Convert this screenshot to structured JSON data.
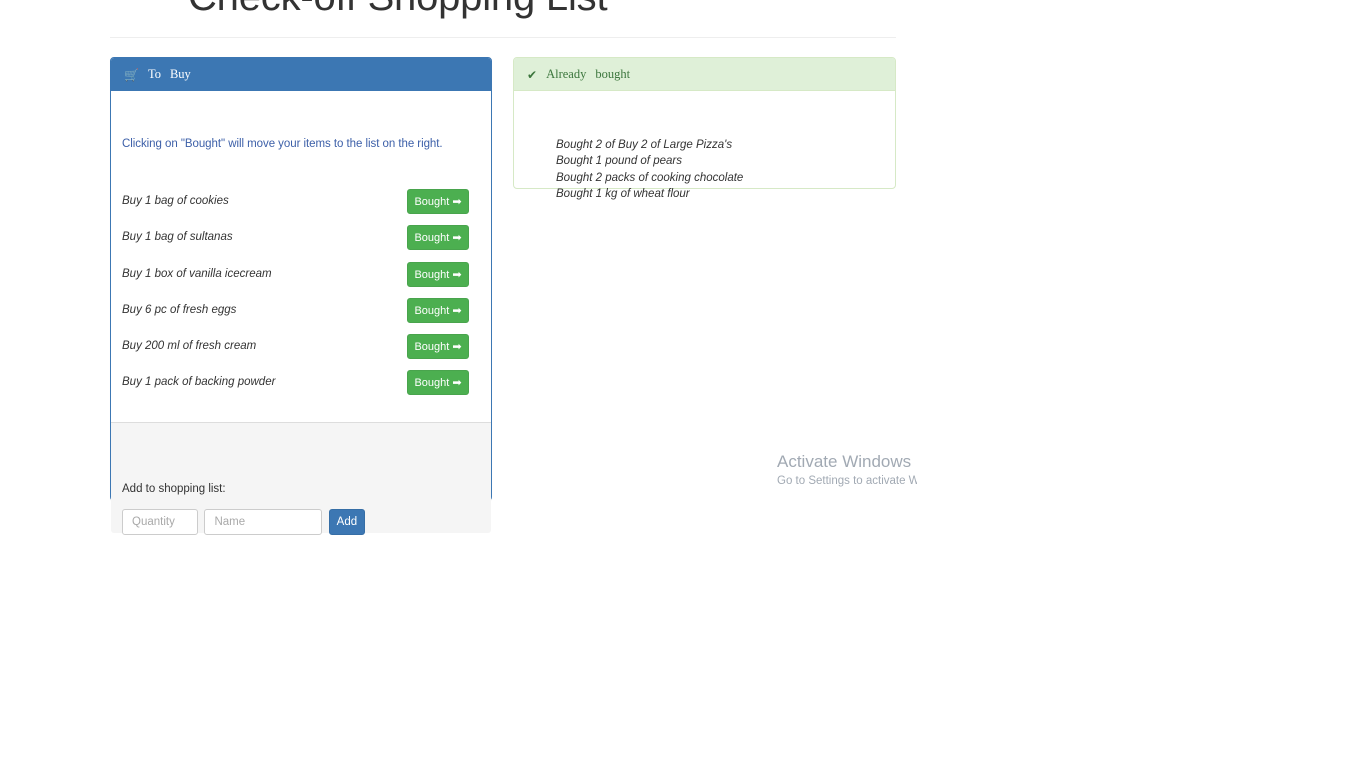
{
  "page": {
    "title": "Check-off Shopping List"
  },
  "colors": {
    "primary_blue": "#3c77b3",
    "success_green_bg": "#dff0d8",
    "success_green_text": "#3c763d",
    "bought_button_green": "#4caf50",
    "note_text_blue": "#3c5fa8",
    "footer_grey": "#f5f5f5"
  },
  "to_buy_panel": {
    "icon": "shopping-cart-icon",
    "icon_glyph": "🛒",
    "heading_word_1": "To",
    "heading_word_2": "Buy",
    "note": "Clicking on \"Bought\" will move your items to the list on the right.",
    "items": [
      {
        "label": "Buy 1 bag of cookies",
        "button": "Bought",
        "arrow": "➡"
      },
      {
        "label": "Buy 1 bag of sultanas",
        "button": "Bought",
        "arrow": "➡"
      },
      {
        "label": "Buy 1 box of vanilla icecream",
        "button": "Bought",
        "arrow": "➡"
      },
      {
        "label": "Buy 6 pc of fresh eggs",
        "button": "Bought",
        "arrow": "➡"
      },
      {
        "label": "Buy 200 ml of fresh cream",
        "button": "Bought",
        "arrow": "➡"
      },
      {
        "label": "Buy 1 pack of backing powder",
        "button": "Bought",
        "arrow": "➡"
      }
    ],
    "footer": {
      "add_label": "Add to shopping list:",
      "quantity_placeholder": "Quantity",
      "quantity_value": "",
      "name_placeholder": "Name",
      "name_value": "",
      "add_button": "Add"
    }
  },
  "already_bought_panel": {
    "icon": "check-mark-icon",
    "icon_glyph": "✔",
    "heading_word_1": "Already",
    "heading_word_2": "bought",
    "items": [
      "Bought 2 of Buy 2 of Large Pizza's",
      "Bought 1 pound of pears",
      "Bought 2 packs of cooking chocolate",
      "Bought 1 kg of wheat flour"
    ]
  },
  "watermark": {
    "title": "Activate Windows",
    "subtitle": "Go to Settings to activate Wi"
  }
}
